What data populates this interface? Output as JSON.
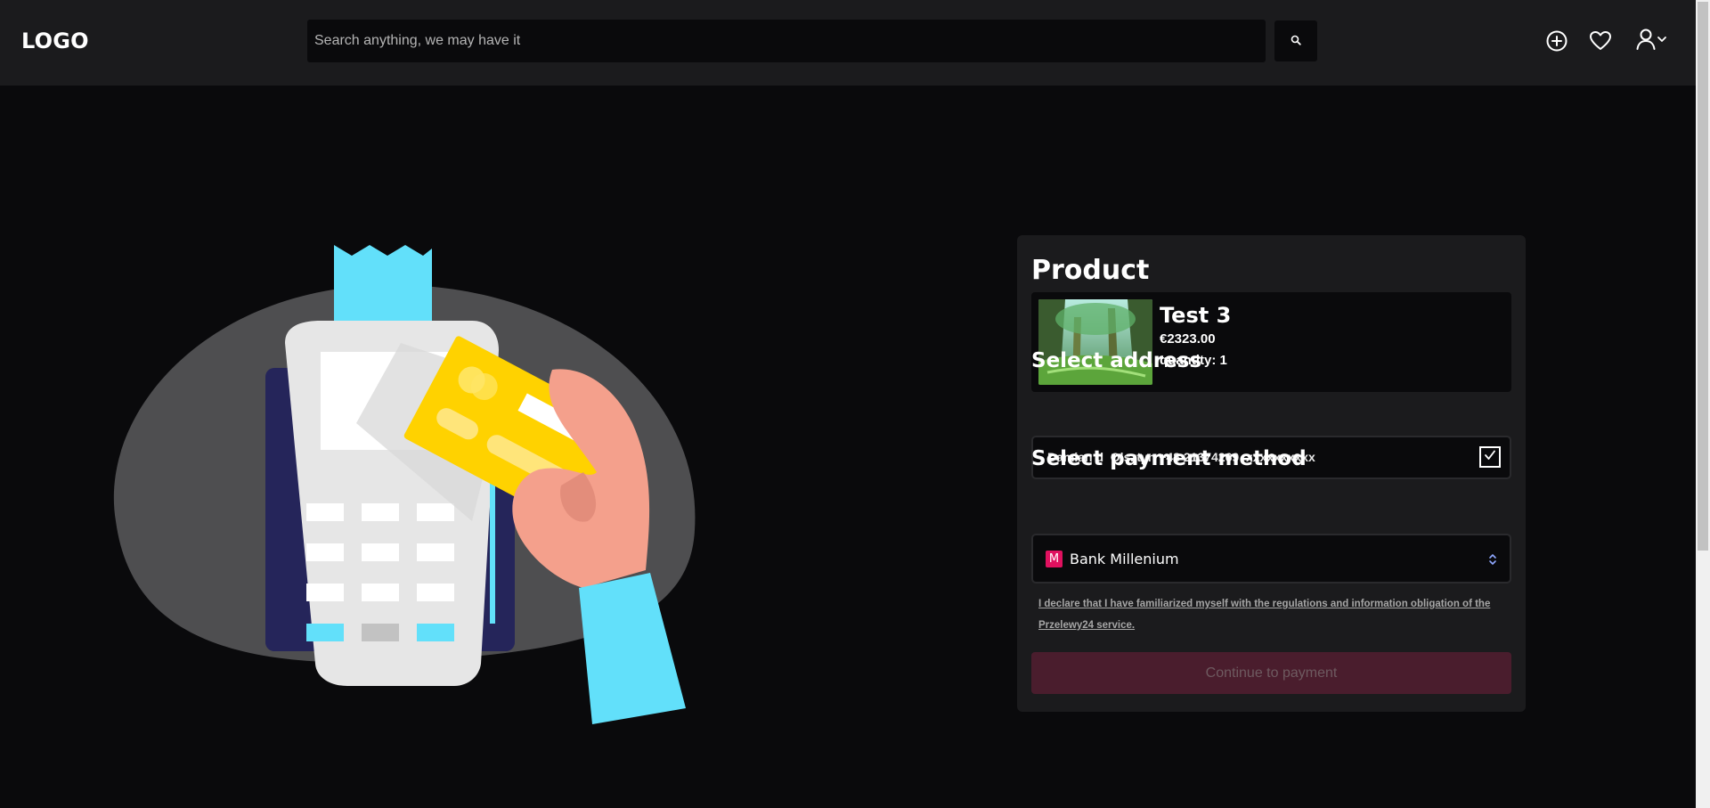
{
  "header": {
    "logo": "LOGO",
    "search": {
      "placeholder": "Search anything, we may have it",
      "value": ""
    },
    "icons": [
      "search-icon",
      "add-circle-icon",
      "heart-icon",
      "user-icon",
      "chevron-down-icon"
    ]
  },
  "checkout": {
    "title": "Product",
    "product": {
      "name": "Test 3",
      "price": "€2323.00",
      "quantity_label": "quantity: 1"
    },
    "address": {
      "section_title": "Select address",
      "text": "Damian d  Olsztyn +48 21374269  xxxxxxxxxx",
      "selected": true
    },
    "payment": {
      "section_title": "Select payment method",
      "bank_icon_letter": "M",
      "selected_bank": "Bank Millenium"
    },
    "declaration": "I declare that I have familiarized myself with the regulations and information obligation of the Przelewy24 service.",
    "continue_label": "Continue to payment"
  },
  "colors": {
    "background": "#0a0a0c",
    "surface": "#1b1b1d",
    "bank_brand": "#e0115f",
    "button_disabled": "#4a1d2d",
    "illustration_receipt": "#62e0fa",
    "illustration_card": "#ffd200",
    "illustration_hand": "#f4a08c"
  }
}
